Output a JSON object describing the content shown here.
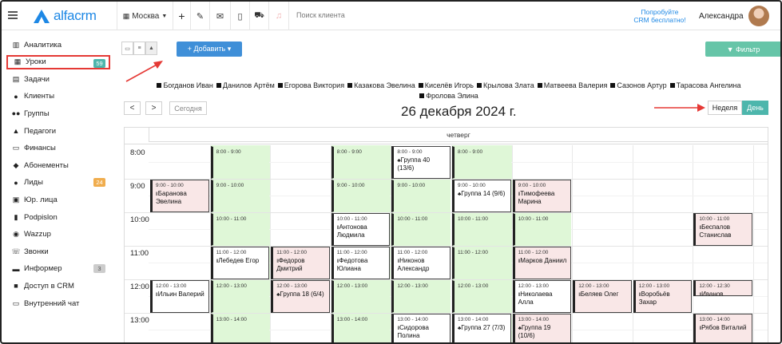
{
  "header": {
    "logo_text": "alfacrm",
    "city": "Москва",
    "search_placeholder": "Поиск клиента",
    "promo_line1": "Попробуйте",
    "promo_line2": "CRM бесплатно!",
    "user_name": "Александра"
  },
  "sidebar": {
    "items": [
      {
        "label": "Аналитика",
        "icon": "analytics-icon",
        "glyph": "▥"
      },
      {
        "label": "Уроки",
        "icon": "calendar-icon",
        "glyph": "▦",
        "badge": "59",
        "active": true
      },
      {
        "label": "Задачи",
        "icon": "clipboard-icon",
        "glyph": "▤"
      },
      {
        "label": "Клиенты",
        "icon": "user-icon",
        "glyph": "●"
      },
      {
        "label": "Группы",
        "icon": "users-icon",
        "glyph": "●●"
      },
      {
        "label": "Педагоги",
        "icon": "graduation-cap-icon",
        "glyph": "▲"
      },
      {
        "label": "Финансы",
        "icon": "money-icon",
        "glyph": "▭"
      },
      {
        "label": "Абонементы",
        "icon": "tag-icon",
        "glyph": "◆"
      },
      {
        "label": "Лиды",
        "icon": "user-plus-icon",
        "glyph": "●",
        "badge": "24"
      },
      {
        "label": "Юр. лица",
        "icon": "briefcase-icon",
        "glyph": "▣"
      },
      {
        "label": "Podpislon",
        "icon": "document-icon",
        "glyph": "▮"
      },
      {
        "label": "Wazzup",
        "icon": "whatsapp-icon",
        "glyph": "◉"
      },
      {
        "label": "Звонки",
        "icon": "phone-icon",
        "glyph": "☏"
      },
      {
        "label": "Информер",
        "icon": "inbox-icon",
        "glyph": "▬",
        "badge": "3"
      },
      {
        "label": "Доступ в CRM",
        "icon": "lock-icon",
        "glyph": "■"
      },
      {
        "label": "Внутренний чат",
        "icon": "chat-icon",
        "glyph": "▭"
      }
    ]
  },
  "toolbar": {
    "add_label": "+ Добавить ▾",
    "filter_label": "▼ Фильтр"
  },
  "legend": [
    "Богданов Иван",
    "Данилов Артём",
    "Егорова Виктория",
    "Казакова Эвелина",
    "Киселёв Игорь",
    "Крылова Злата",
    "Матвеева Валерия",
    "Сазонов Артур",
    "Тарасова Ангелина",
    "Фролова Элина"
  ],
  "calendar": {
    "prev": "<",
    "next": ">",
    "today_label": "Сегодня",
    "date_title": "26 декабря 2024 г.",
    "week_label": "Неделя",
    "day_label": "День",
    "day_header": "четверг",
    "hours": [
      "8:00",
      "9:00",
      "10:00",
      "11:00",
      "12:00",
      "13:00"
    ],
    "events": [
      {
        "col": 0,
        "start": 1,
        "span": 1,
        "time": "9:00 - 10:00",
        "icon": "ǁ",
        "name": "Баранова Эвелина",
        "style": "pink"
      },
      {
        "col": 0,
        "start": 4,
        "span": 1,
        "time": "12:00 - 13:00",
        "icon": "ǁ",
        "name": "Ильин Валерий",
        "style": "white"
      },
      {
        "col": 1,
        "start": 0,
        "span": 1,
        "time": "8:00 - 9:00",
        "icon": "",
        "name": "",
        "style": "green"
      },
      {
        "col": 1,
        "start": 1,
        "span": 1,
        "time": "9:00 - 10:00",
        "icon": "",
        "name": "",
        "style": "green"
      },
      {
        "col": 1,
        "start": 2,
        "span": 1,
        "time": "10:00 - 11:00",
        "icon": "",
        "name": "",
        "style": "green"
      },
      {
        "col": 1,
        "start": 3,
        "span": 1,
        "time": "11:00 - 12:00",
        "icon": "ǁ",
        "name": "Лебедев Егор",
        "style": "white"
      },
      {
        "col": 1,
        "start": 4,
        "span": 1,
        "time": "12:00 - 13:00",
        "icon": "",
        "name": "",
        "style": "green"
      },
      {
        "col": 1,
        "start": 5,
        "span": 1,
        "time": "13:00 - 14:00",
        "icon": "",
        "name": "",
        "style": "green"
      },
      {
        "col": 2,
        "start": 3,
        "span": 1,
        "time": "11:00 - 12:00",
        "icon": "ǁ",
        "name": "Федоров Дмитрий",
        "style": "pink"
      },
      {
        "col": 2,
        "start": 4,
        "span": 1,
        "time": "12:00 - 13:00",
        "icon": "♣",
        "name": "Группа 18 (6/4)",
        "style": "pink"
      },
      {
        "col": 3,
        "start": 0,
        "span": 1,
        "time": "8:00 - 9:00",
        "icon": "",
        "name": "",
        "style": "green"
      },
      {
        "col": 3,
        "start": 1,
        "span": 1,
        "time": "9:00 - 10:00",
        "icon": "",
        "name": "",
        "style": "green"
      },
      {
        "col": 3,
        "start": 2,
        "span": 1,
        "time": "10:00 - 11:00",
        "icon": "ǁ",
        "name": "Антонова Людмила",
        "style": "white"
      },
      {
        "col": 3,
        "start": 3,
        "span": 1,
        "time": "11:00 - 12:00",
        "icon": "ǁ",
        "name": "Федотова Юлиана",
        "style": "white"
      },
      {
        "col": 3,
        "start": 4,
        "span": 1,
        "time": "12:00 - 13:00",
        "icon": "",
        "name": "",
        "style": "green"
      },
      {
        "col": 3,
        "start": 5,
        "span": 1,
        "time": "13:00 - 14:00",
        "icon": "",
        "name": "",
        "style": "green"
      },
      {
        "col": 4,
        "start": 0,
        "span": 1,
        "time": "8:00 - 9:00",
        "icon": "♣",
        "name": "Группа 40 (13/6)",
        "style": "white"
      },
      {
        "col": 4,
        "start": 1,
        "span": 1,
        "time": "9:00 - 10:00",
        "icon": "",
        "name": "",
        "style": "green"
      },
      {
        "col": 4,
        "start": 2,
        "span": 1,
        "time": "10:00 - 11:00",
        "icon": "",
        "name": "",
        "style": "green"
      },
      {
        "col": 4,
        "start": 3,
        "span": 1,
        "time": "11:00 - 12:00",
        "icon": "ǁ",
        "name": "Никонов Александр",
        "style": "white"
      },
      {
        "col": 4,
        "start": 4,
        "span": 1,
        "time": "12:00 - 13:00",
        "icon": "",
        "name": "",
        "style": "green"
      },
      {
        "col": 4,
        "start": 5,
        "span": 1,
        "time": "13:00 - 14:00",
        "icon": "ǁ",
        "name": "Сидорова Полина",
        "style": "white"
      },
      {
        "col": 5,
        "start": 0,
        "span": 1,
        "time": "8:00 - 9:00",
        "icon": "",
        "name": "",
        "style": "green"
      },
      {
        "col": 5,
        "start": 1,
        "span": 1,
        "time": "9:00 - 10:00",
        "icon": "♣",
        "name": "Группа 14 (9/6)",
        "style": "white"
      },
      {
        "col": 5,
        "start": 2,
        "span": 1,
        "time": "10:00 - 11:00",
        "icon": "",
        "name": "",
        "style": "green"
      },
      {
        "col": 5,
        "start": 3,
        "span": 1,
        "time": "11:00 - 12:00",
        "icon": "",
        "name": "",
        "style": "green"
      },
      {
        "col": 5,
        "start": 4,
        "span": 1,
        "time": "12:00 - 13:00",
        "icon": "",
        "name": "",
        "style": "green"
      },
      {
        "col": 5,
        "start": 5,
        "span": 1,
        "time": "13:00 - 14:00",
        "icon": "♣",
        "name": "Группа 27 (7/3)",
        "style": "white"
      },
      {
        "col": 6,
        "start": 1,
        "span": 1,
        "time": "9:00 - 10:00",
        "icon": "ǁ",
        "name": "Тимофеева Марина",
        "style": "pink"
      },
      {
        "col": 6,
        "start": 2,
        "span": 1,
        "time": "10:00 - 11:00",
        "icon": "",
        "name": "",
        "style": "green"
      },
      {
        "col": 6,
        "start": 3,
        "span": 1,
        "time": "11:00 - 12:00",
        "icon": "ǁ",
        "name": "Марков Даниил",
        "style": "pink"
      },
      {
        "col": 6,
        "start": 4,
        "span": 1,
        "time": "12:00 - 13:00",
        "icon": "ǁ",
        "name": "Николаева Алла",
        "style": "white"
      },
      {
        "col": 6,
        "start": 5,
        "span": 1,
        "time": "13:00 - 14:00",
        "icon": "♣",
        "name": "Группа 19 (10/6)",
        "style": "pink"
      },
      {
        "col": 7,
        "start": 4,
        "span": 1,
        "time": "12:00 - 13:00",
        "icon": "ǁ",
        "name": "Беляев Олег",
        "style": "pink"
      },
      {
        "col": 8,
        "start": 4,
        "span": 1,
        "time": "12:00 - 13:00",
        "icon": "ǁ",
        "name": "Воробьёв Захар",
        "style": "pink"
      },
      {
        "col": 9,
        "start": 2,
        "span": 1,
        "time": "10:00 - 11:00",
        "icon": "ǁ",
        "name": "Беспалов Станислав",
        "style": "pink"
      },
      {
        "col": 9,
        "start": 4,
        "span": 0.5,
        "time": "12:00 - 12:30",
        "icon": "ǁ",
        "name": "Иванов",
        "style": "pink"
      },
      {
        "col": 9,
        "start": 5,
        "span": 1,
        "time": "13:00 - 14:00",
        "icon": "ǁ",
        "name": "Рябов Виталий",
        "style": "pink"
      }
    ]
  },
  "colors": {
    "accent": "#1e88e5",
    "add_button": "#3f8fd8",
    "filter_button": "#66c5a8",
    "teal": "#4db6ac",
    "free_slot_green": "#dff7d7",
    "event_pink": "#f9e7e7",
    "annotation_red": "#e53935"
  }
}
